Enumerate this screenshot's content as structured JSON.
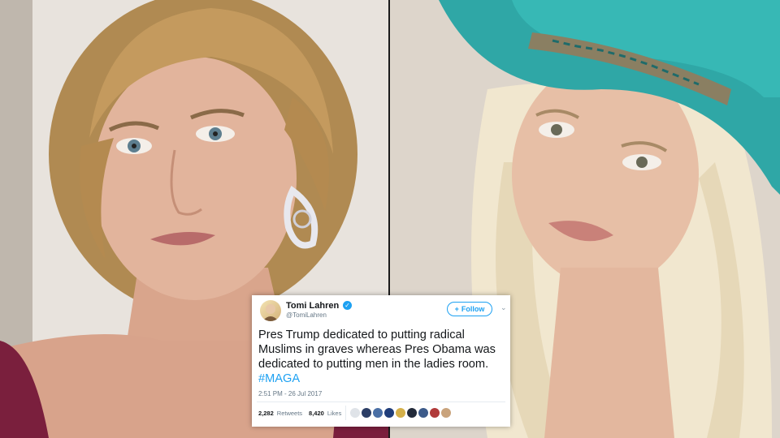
{
  "tweet": {
    "name": "Tomi Lahren",
    "handle": "@TomiLahren",
    "follow_label": "Follow",
    "text": "Pres Trump dedicated to putting radical Muslims in graves whereas Pres Obama was dedicated to putting men in the ladies room.",
    "hashtag": "#MAGA",
    "timestamp": "2:51 PM - 26 Jul 2017",
    "retweets_count": "2,282",
    "retweets_label": "Retweets",
    "likes_count": "8,420",
    "likes_label": "Likes",
    "accent_color": "#1da1f2"
  },
  "icons": {
    "verified": "verified-badge-icon",
    "follow": "add-person-icon",
    "menu": "chevron-down-icon"
  }
}
